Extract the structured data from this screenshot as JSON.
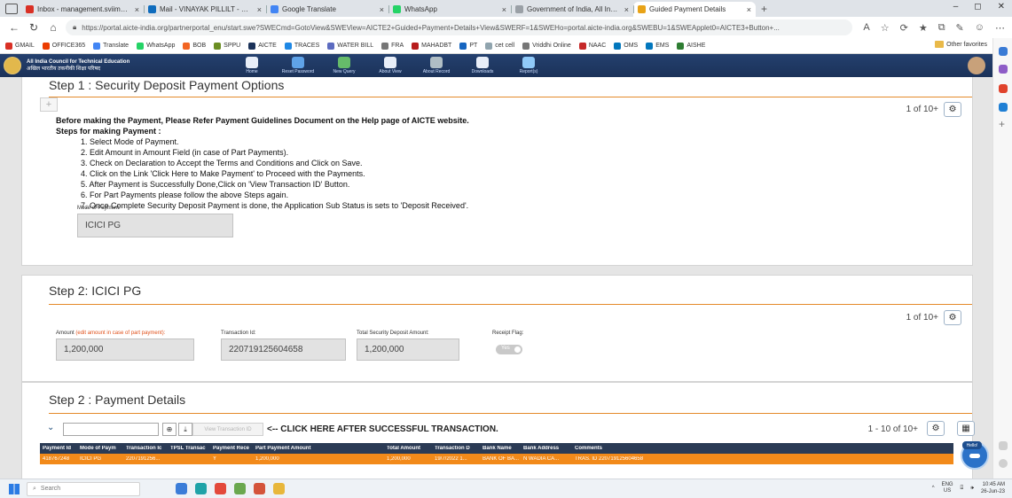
{
  "browser": {
    "tabs": [
      {
        "title": "Inbox - management.sviims@gm",
        "color": "#d93025",
        "active": false
      },
      {
        "title": "Mail - VINAYAK PILLILT - Outlook",
        "color": "#0f6cbd",
        "active": false
      },
      {
        "title": "Google Translate",
        "color": "#4285f4",
        "active": false
      },
      {
        "title": "WhatsApp",
        "color": "#25d366",
        "active": false
      },
      {
        "title": "Government of India, All India C",
        "color": "#9aa0a6",
        "active": false
      },
      {
        "title": "Guided Payment Details",
        "color": "#e8a317",
        "active": true
      }
    ],
    "new_tab": "+",
    "url": "https://portal.aicte-india.org/partnerportal_enu/start.swe?SWECmd=GotoView&SWEView=AICTE2+Guided+Payment+Details+View&SWERF=1&SWEHo=portal.aicte-india.org&SWEBU=1&SWEApplet0=AICTE3+Button+...",
    "bookmarks": [
      {
        "label": "GMAIL",
        "color": "#d93025"
      },
      {
        "label": "OFFICE365",
        "color": "#eb3c00"
      },
      {
        "label": "Translate",
        "color": "#4285f4"
      },
      {
        "label": "WhatsApp",
        "color": "#25d366"
      },
      {
        "label": "BOB",
        "color": "#f26522"
      },
      {
        "label": "SPPU",
        "color": "#6b8e23"
      },
      {
        "label": "AICTE",
        "color": "#1b3259"
      },
      {
        "label": "TRACES",
        "color": "#1e88e5"
      },
      {
        "label": "WATER BILL",
        "color": "#5c6bc0"
      },
      {
        "label": "FRA",
        "color": "#777777"
      },
      {
        "label": "MAHADBT",
        "color": "#b71c1c"
      },
      {
        "label": "PT",
        "color": "#1565c0"
      },
      {
        "label": "cet cell",
        "color": "#90a4ae"
      },
      {
        "label": "Vriddhi Online",
        "color": "#777777"
      },
      {
        "label": "NAAC",
        "color": "#c62828"
      },
      {
        "label": "OMS",
        "color": "#0277bd"
      },
      {
        "label": "EMS",
        "color": "#0277bd"
      },
      {
        "label": "AISHE",
        "color": "#2e7d32"
      }
    ],
    "other_favorites": "Other favorites"
  },
  "app": {
    "org_line1": "All India Council for Technical Education",
    "org_line2": "अखिल भारतीय तकनीकी शिक्षा परिषद",
    "nav": [
      {
        "label": "Home",
        "color": "#e8eef8"
      },
      {
        "label": "Reset Password",
        "color": "#5fa3e8"
      },
      {
        "label": "New Query",
        "color": "#66bb6a"
      },
      {
        "label": "About View",
        "color": "#e8eef8"
      },
      {
        "label": "About Record",
        "color": "#b0bec5"
      },
      {
        "label": "Downloads",
        "color": "#e8eef8"
      },
      {
        "label": "Report(s)",
        "color": "#90caf9"
      }
    ]
  },
  "step1": {
    "title": "Step 1 : Security Deposit Payment Options",
    "pager": "1 of 10+",
    "intro": "Before making the Payment, Please Refer Payment Guidelines Document on the Help page of AICTE website.",
    "steps_heading": "Steps for making Payment :",
    "steps": [
      "1. Select Mode of Payment.",
      "2. Edit Amount in Amount Field (in case of Part Payments).",
      "3. Check on Declaration to Accept the Terms and Conditions and Click on Save.",
      "4. Click on the Link 'Click Here to Make Payment' to Proceed with the Payments.",
      "5. After Payment is Successfully Done,Click on 'View Transaction ID' Button.",
      "6. For Part Payments please follow the above Steps again.",
      "7. Once Complete Security Deposit Payment is done, the Application Sub Status is sets to 'Deposit Received'."
    ],
    "mode_label": "Mode of Payment:",
    "mode_value": "ICICI PG"
  },
  "step2": {
    "title": "Step 2: ICICI PG",
    "pager": "1 of 10+",
    "amount_label": "Amount",
    "amount_hint": "(edit amount in case of part payment):",
    "amount_value": "1,200,000",
    "txn_label": "Transaction Id:",
    "txn_value": "220719125604658",
    "total_label": "Total Security Deposit Amount:",
    "total_value": "1,200,000",
    "receipt_label": "Receipt Flag:",
    "receipt_value": "Yes"
  },
  "step3": {
    "title": "Step 2 : Payment Details",
    "view_txn_button": "View Transaction ID",
    "click_here_text": "<-- CLICK HERE AFTER SUCCESSFUL TRANSACTION.",
    "pager": "1 - 10 of 10+",
    "columns": [
      "Payment Id",
      "Mode of Paym",
      "Transaction Ic",
      "TPSL Transac",
      "Payment Rece",
      "Part Payment Amount",
      "Total Amount",
      "Transaction D",
      "Bank Name",
      "Bank Address",
      "Comments"
    ],
    "rows": [
      [
        "418767248",
        "ICICI PG",
        "2207191256...",
        "",
        "Y",
        "1,200,000",
        "1,200,000",
        "19/7/2022 1...",
        "BANK OF BA...",
        "N WADIA CA...",
        "TRAS. ID 220719125604658"
      ]
    ]
  },
  "chatbot": {
    "badge": "Hello!"
  },
  "taskbar": {
    "search_placeholder": "Search",
    "apps": [
      {
        "name": "file-explorer",
        "color": "#3b7dd8"
      },
      {
        "name": "edge",
        "color": "#1fa3a8"
      },
      {
        "name": "chrome",
        "color": "#e3493b"
      },
      {
        "name": "mail",
        "color": "#6aa84f"
      },
      {
        "name": "store",
        "color": "#d4543b"
      },
      {
        "name": "files",
        "color": "#e8b73b"
      }
    ],
    "lang_top": "ENG",
    "lang_bottom": "US",
    "time": "10:45 AM",
    "date": "26-Jun-23"
  }
}
